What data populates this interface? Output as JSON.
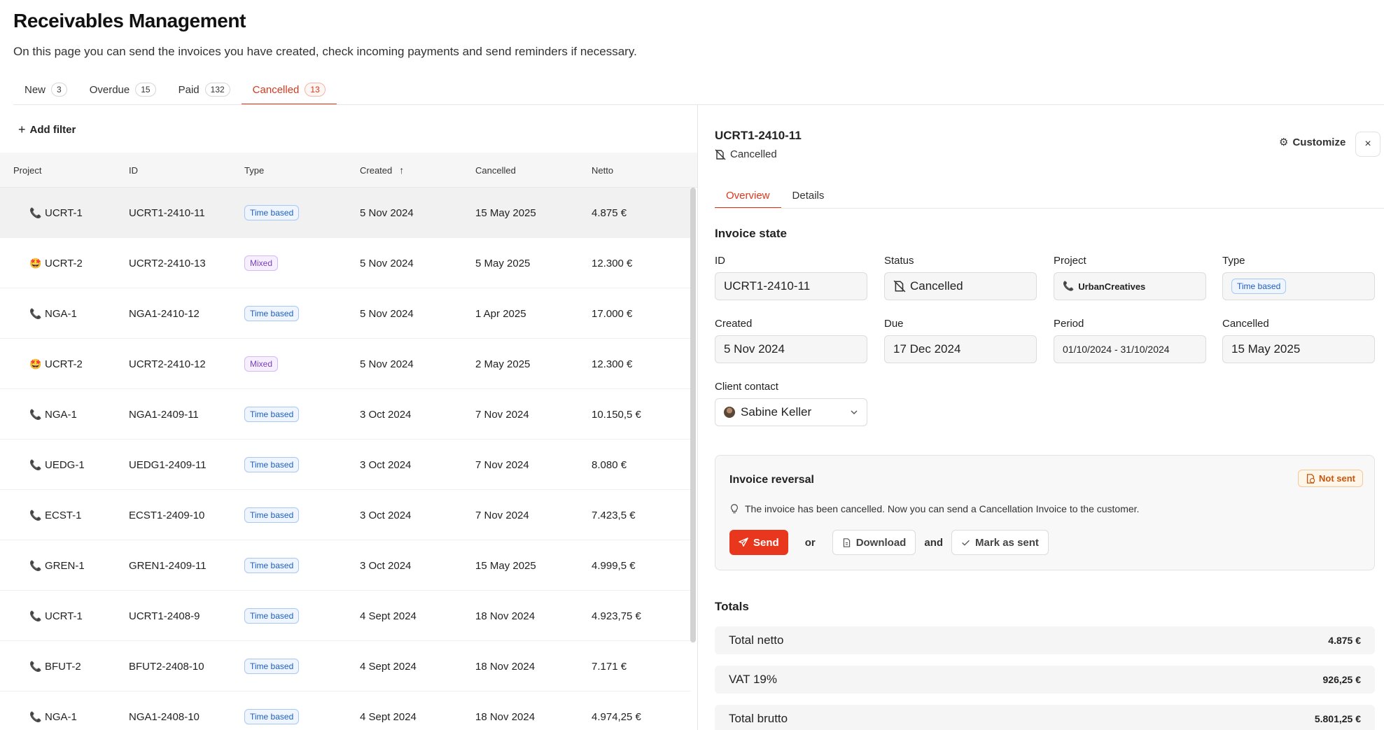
{
  "header": {
    "title": "Receivables Management",
    "description": "On this page you can send the invoices you have created, check incoming payments and send reminders if necessary."
  },
  "tabs": [
    {
      "label": "New",
      "count": "3"
    },
    {
      "label": "Overdue",
      "count": "15"
    },
    {
      "label": "Paid",
      "count": "132"
    },
    {
      "label": "Cancelled",
      "count": "13"
    }
  ],
  "filter": {
    "add_label": "Add filter"
  },
  "table": {
    "columns": {
      "project": "Project",
      "id": "ID",
      "type": "Type",
      "created": "Created",
      "cancelled": "Cancelled",
      "netto": "Netto"
    },
    "rows": [
      {
        "icon": "📞",
        "project": "UCRT-1",
        "id": "UCRT1-2410-11",
        "type": "Time based",
        "created": "5 Nov 2024",
        "cancelled": "15 May 2025",
        "netto": "4.875 €"
      },
      {
        "icon": "🤩",
        "project": "UCRT-2",
        "id": "UCRT2-2410-13",
        "type": "Mixed",
        "created": "5 Nov 2024",
        "cancelled": "5 May 2025",
        "netto": "12.300 €"
      },
      {
        "icon": "📞",
        "project": "NGA-1",
        "id": "NGA1-2410-12",
        "type": "Time based",
        "created": "5 Nov 2024",
        "cancelled": "1 Apr 2025",
        "netto": "17.000 €"
      },
      {
        "icon": "🤩",
        "project": "UCRT-2",
        "id": "UCRT2-2410-12",
        "type": "Mixed",
        "created": "5 Nov 2024",
        "cancelled": "2 May 2025",
        "netto": "12.300 €"
      },
      {
        "icon": "📞",
        "project": "NGA-1",
        "id": "NGA1-2409-11",
        "type": "Time based",
        "created": "3 Oct 2024",
        "cancelled": "7 Nov 2024",
        "netto": "10.150,5 €"
      },
      {
        "icon": "📞",
        "project": "UEDG-1",
        "id": "UEDG1-2409-11",
        "type": "Time based",
        "created": "3 Oct 2024",
        "cancelled": "7 Nov 2024",
        "netto": "8.080 €"
      },
      {
        "icon": "📞",
        "project": "ECST-1",
        "id": "ECST1-2409-10",
        "type": "Time based",
        "created": "3 Oct 2024",
        "cancelled": "7 Nov 2024",
        "netto": "7.423,5 €"
      },
      {
        "icon": "📞",
        "project": "GREN-1",
        "id": "GREN1-2409-11",
        "type": "Time based",
        "created": "3 Oct 2024",
        "cancelled": "15 May 2025",
        "netto": "4.999,5 €"
      },
      {
        "icon": "📞",
        "project": "UCRT-1",
        "id": "UCRT1-2408-9",
        "type": "Time based",
        "created": "4 Sept 2024",
        "cancelled": "18 Nov 2024",
        "netto": "4.923,75 €"
      },
      {
        "icon": "📞",
        "project": "BFUT-2",
        "id": "BFUT2-2408-10",
        "type": "Time based",
        "created": "4 Sept 2024",
        "cancelled": "18 Nov 2024",
        "netto": "7.171 €"
      },
      {
        "icon": "📞",
        "project": "NGA-1",
        "id": "NGA1-2408-10",
        "type": "Time based",
        "created": "4 Sept 2024",
        "cancelled": "18 Nov 2024",
        "netto": "4.974,25 €"
      }
    ]
  },
  "detail": {
    "title": "UCRT1-2410-11",
    "status": "Cancelled",
    "customize_label": "Customize",
    "close_label": "×",
    "tabs": {
      "overview": "Overview",
      "details": "Details"
    },
    "section_invoice_state": "Invoice state",
    "fields": {
      "id": {
        "label": "ID",
        "value": "UCRT1-2410-11"
      },
      "status": {
        "label": "Status",
        "value": "Cancelled"
      },
      "project": {
        "label": "Project",
        "value": "UrbanCreatives"
      },
      "type": {
        "label": "Type",
        "value": "Time based"
      },
      "created": {
        "label": "Created",
        "value": "5 Nov 2024"
      },
      "due": {
        "label": "Due",
        "value": "17 Dec 2024"
      },
      "period": {
        "label": "Period",
        "value": "01/10/2024 - 31/10/2024"
      },
      "cancelled": {
        "label": "Cancelled",
        "value": "15 May 2025"
      },
      "client_contact": {
        "label": "Client contact",
        "value": "Sabine Keller"
      }
    },
    "reversal": {
      "title": "Invoice reversal",
      "badge": "Not sent",
      "hint": "The invoice has been cancelled. Now you can send a Cancellation Invoice to the customer.",
      "send": "Send",
      "or": "or",
      "download": "Download",
      "and": "and",
      "mark_sent": "Mark as sent"
    },
    "totals": {
      "title": "Totals",
      "rows": [
        {
          "label": "Total netto",
          "value": "4.875 €"
        },
        {
          "label": "VAT 19%",
          "value": "926,25 €"
        },
        {
          "label": "Total brutto",
          "value": "5.801,25 €"
        }
      ]
    }
  },
  "colors": {
    "accent": "#d9381e",
    "send_button": "#e8371c",
    "time_badge": "#1e5fbf",
    "mixed_badge": "#7b3fb8"
  }
}
